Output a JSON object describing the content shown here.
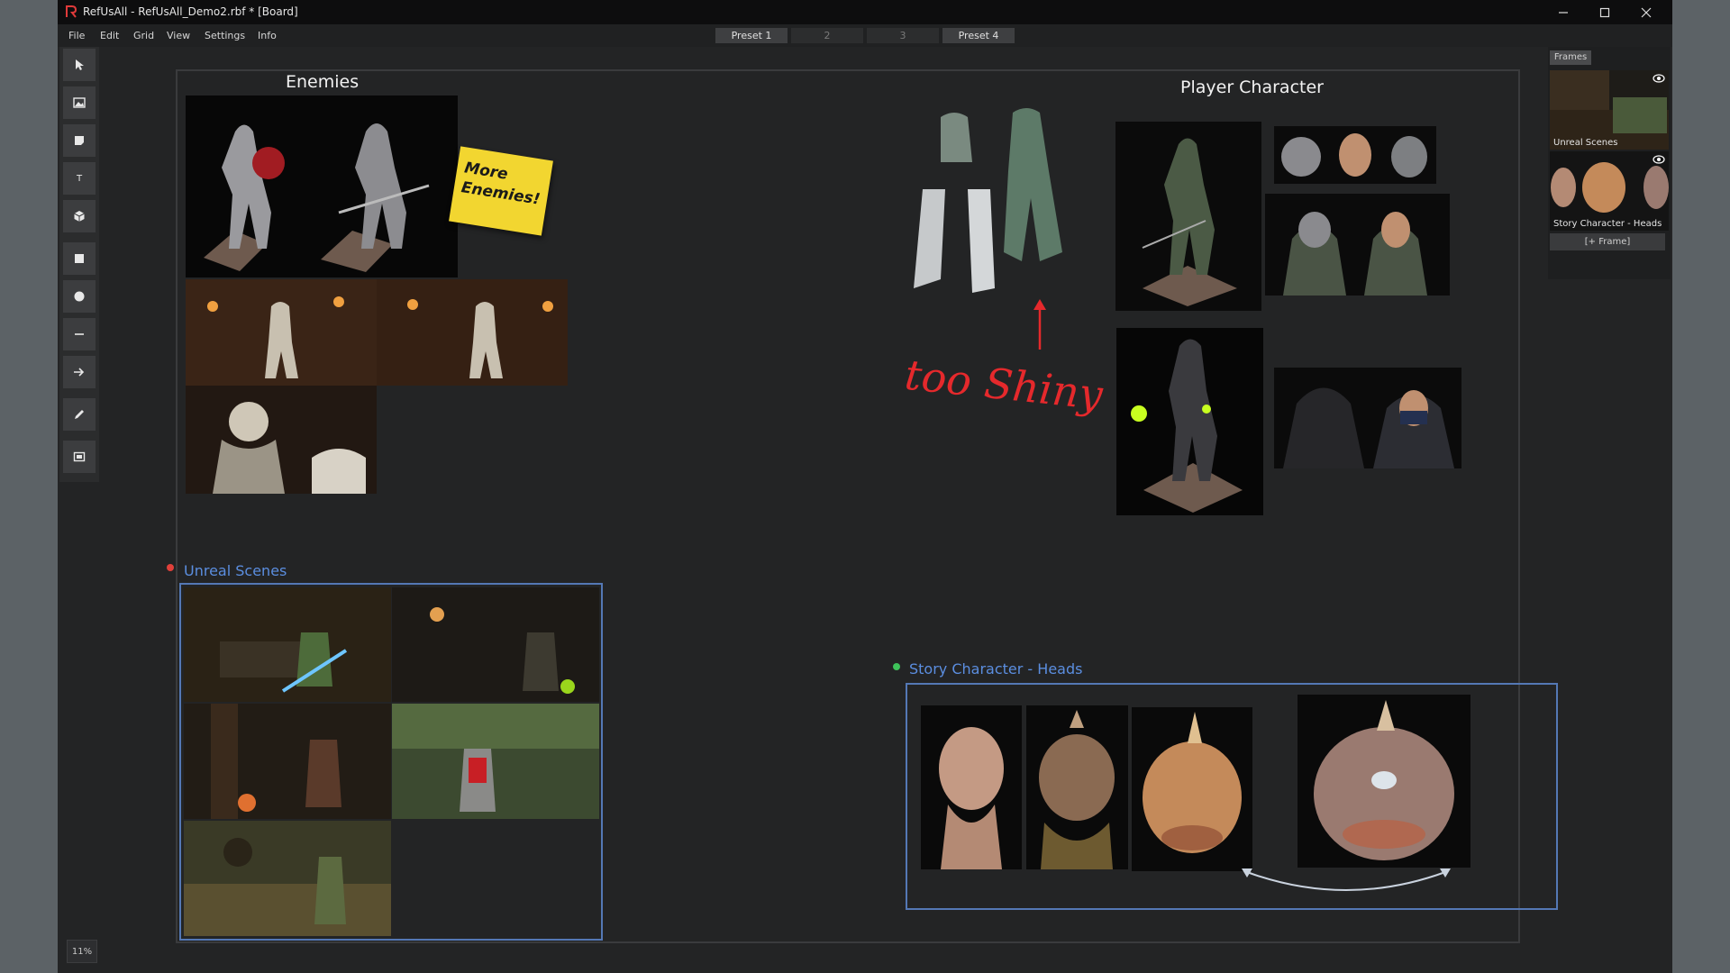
{
  "window": {
    "title": "RefUsAll - RefUsAll_Demo2.rbf * [Board]",
    "minimize_icon": "minimize-icon",
    "maximize_icon": "maximize-icon",
    "close_icon": "close-icon"
  },
  "menu": [
    "File",
    "Edit",
    "Grid",
    "View",
    "Settings",
    "Info"
  ],
  "presets": [
    "Preset 1",
    "2",
    "3",
    "Preset 4"
  ],
  "tools": [
    "select-arrow-icon",
    "image-icon",
    "sticky-note-icon",
    "text-icon",
    "3d-cube-icon",
    "rectangle-icon",
    "circle-icon",
    "line-icon",
    "arrow-icon",
    "pencil-icon",
    "frame-icon"
  ],
  "tool_text_glyph": "T",
  "zoom": "11%",
  "board": {
    "enemies_heading": "Enemies",
    "player_heading": "Player Character",
    "sticky_note": "More Enemies!",
    "handwritten_note": "too Shiny",
    "unreal_frame_title": "Unreal Scenes",
    "story_frame_title": "Story Character - Heads"
  },
  "frames_panel": {
    "tab": "Frames",
    "items": [
      "Unreal Scenes",
      "Story Character - Heads"
    ],
    "add_button": "[+ Frame]"
  },
  "colors": {
    "accent_blue": "#5b8ee0",
    "unreal_dot": "#e0403a",
    "story_dot": "#3ec25a",
    "sticky": "#f2d630",
    "note_red": "#e5292c"
  }
}
